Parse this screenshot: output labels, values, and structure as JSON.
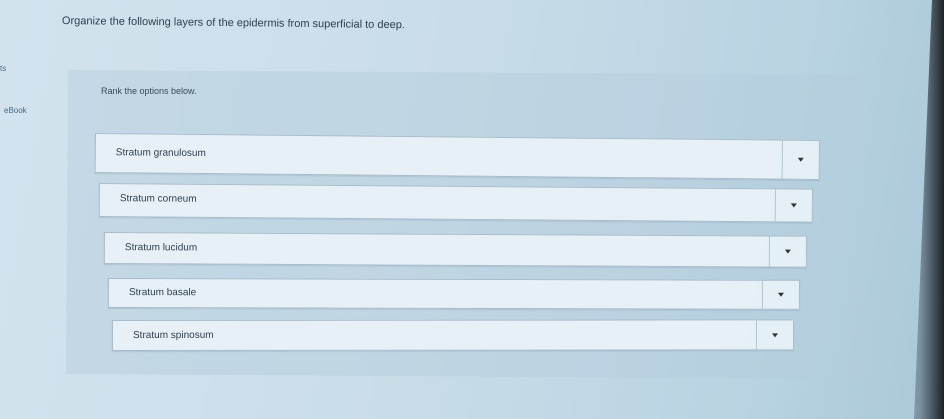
{
  "sidebar": {
    "partial_label": "ts",
    "ebook_label": "eBook"
  },
  "question": {
    "text": "Organize the following layers of the epidermis from superficial to deep."
  },
  "ranking": {
    "instruction": "Rank the options below.",
    "items": [
      {
        "label": "Stratum granulosum"
      },
      {
        "label": "Stratum corneum"
      },
      {
        "label": "Stratum lucidum"
      },
      {
        "label": "Stratum basale"
      },
      {
        "label": "Stratum spinosum"
      }
    ],
    "dropdown_icon": "caret-down-icon"
  },
  "colors": {
    "background": "#c9dde9",
    "item_background": "#e8f1f7",
    "item_border": "#a8bccb",
    "text": "#2f3f4f"
  }
}
